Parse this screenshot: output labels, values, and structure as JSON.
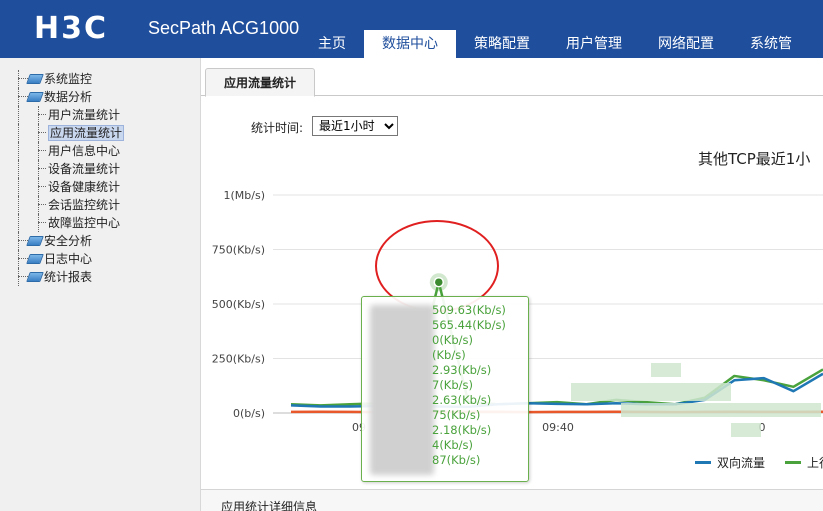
{
  "header": {
    "logo": "H3C",
    "product": "SecPath ACG1000",
    "nav": [
      "主页",
      "数据中心",
      "策略配置",
      "用户管理",
      "网络配置",
      "系统管"
    ],
    "active_index": 1
  },
  "sidebar": {
    "items": [
      {
        "label": "系统监控",
        "level": 1
      },
      {
        "label": "数据分析",
        "level": 1
      },
      {
        "label": "用户流量统计",
        "level": 2
      },
      {
        "label": "应用流量统计",
        "level": 2,
        "selected": true
      },
      {
        "label": "用户信息中心",
        "level": 2
      },
      {
        "label": "设备流量统计",
        "level": 2
      },
      {
        "label": "设备健康统计",
        "level": 2
      },
      {
        "label": "会话监控统计",
        "level": 2
      },
      {
        "label": "故障监控中心",
        "level": 2
      },
      {
        "label": "安全分析",
        "level": 1
      },
      {
        "label": "日志中心",
        "level": 1
      },
      {
        "label": "统计报表",
        "level": 1
      }
    ]
  },
  "main": {
    "tab": "应用流量统计",
    "time_label": "统计时间:",
    "time_select": "最近1小时",
    "bottom_title": "应用统计详细信息"
  },
  "tooltip": {
    "lines": [
      "509.63(Kb/s)",
      "565.44(Kb/s)",
      "0(Kb/s)",
      "(Kb/s)",
      "2.93(Kb/s)",
      "7(Kb/s)",
      "2.63(Kb/s)",
      "75(Kb/s)",
      "2.18(Kb/s)",
      "4(Kb/s)",
      "87(Kb/s)"
    ]
  },
  "chart_data": {
    "type": "line",
    "title": "其他TCP最近1小",
    "y_ticks": [
      "1(Mb/s)",
      "750(Kb/s)",
      "500(Kb/s)",
      "250(Kb/s)",
      "0(b/s)"
    ],
    "y_values": [
      1000,
      750,
      500,
      250,
      0
    ],
    "x_ticks": [
      "09",
      "09:40",
      "0"
    ],
    "ylim": [
      0,
      1000
    ],
    "series": [
      {
        "name": "双向流量",
        "color": "#1f77b4",
        "values": [
          35,
          30,
          30,
          32,
          35,
          30,
          28,
          40,
          45,
          42,
          40,
          45,
          40,
          40,
          60,
          150,
          160,
          100,
          180
        ]
      },
      {
        "name": "上行",
        "color": "#4aa23c",
        "values": [
          40,
          35,
          40,
          45,
          50,
          600,
          50,
          40,
          45,
          50,
          40,
          60,
          50,
          40,
          70,
          170,
          150,
          120,
          200
        ]
      },
      {
        "values": [
          5,
          6,
          5,
          4,
          6,
          5,
          5,
          6,
          4,
          5,
          5,
          6,
          5,
          4,
          5,
          6,
          5,
          5,
          6
        ],
        "color": "#e8582a"
      }
    ],
    "highlight_value": 600,
    "legend_position": "bottom-right"
  }
}
